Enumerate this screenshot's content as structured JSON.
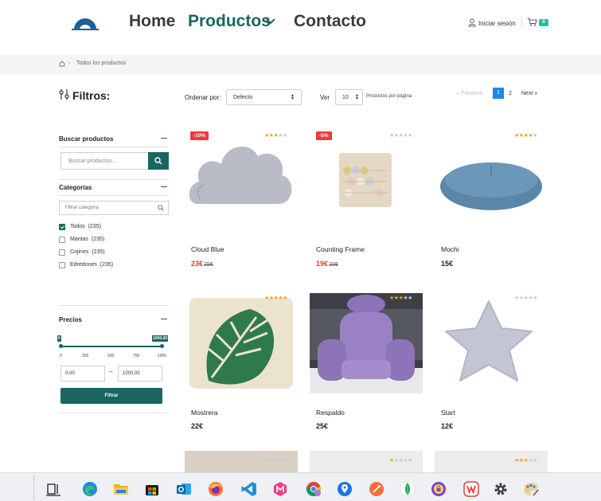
{
  "header": {
    "nav": {
      "home": "Home",
      "products": "Productos",
      "contact": "Contacto"
    },
    "login": "Iniciar sesión",
    "cart_count": "0"
  },
  "breadcrumb": {
    "current": "Todos los productos"
  },
  "sidebar": {
    "title": "Filtros:",
    "search": {
      "title": "Buscar productos",
      "placeholder": "Buscar productos..."
    },
    "categories": {
      "title": "Categorías",
      "filter_placeholder": "Filtrar categoría",
      "items": [
        {
          "label": "Todos",
          "count": "(235)",
          "checked": true
        },
        {
          "label": "Mantas",
          "count": "(235)",
          "checked": false
        },
        {
          "label": "Cojines",
          "count": "(235)",
          "checked": false
        },
        {
          "label": "Edredones",
          "count": "(235)",
          "checked": false
        }
      ]
    },
    "prices": {
      "title": "Precios",
      "range": [
        0,
        1000
      ],
      "handle_min": "0",
      "handle_max": "1000,00",
      "ticks": [
        "0",
        "250",
        "500",
        "750",
        "1000"
      ],
      "min_value": "0,00",
      "max_value": "1000,00",
      "dash": "–",
      "button": "Filtrar"
    }
  },
  "toolbar": {
    "order_label": "Ordenar por:",
    "order_value": "Defecto",
    "ver_label": "Ver",
    "ver_value": "10",
    "per_page": "Productos por página",
    "pagination": {
      "prev": "« Previous",
      "page1": "1",
      "page2": "2",
      "next": "Next »"
    }
  },
  "products": [
    {
      "name": "Cloud Blue",
      "price": "23€",
      "old_price": "25€",
      "badge": "-10%",
      "rating": 3
    },
    {
      "name": "Counting Frame",
      "price": "19€",
      "old_price": "20€",
      "badge": "-5%",
      "rating": 0
    },
    {
      "name": "Mochi",
      "price": "15€",
      "old_price": "",
      "badge": "",
      "rating": 4
    },
    {
      "name": "Mostrera",
      "price": "22€",
      "old_price": "",
      "badge": "",
      "rating": 5
    },
    {
      "name": "Respaldo",
      "price": "25€",
      "old_price": "",
      "badge": "",
      "rating": 3
    },
    {
      "name": "Start",
      "price": "12€",
      "old_price": "",
      "badge": "",
      "rating": 0
    },
    {
      "rating": 0
    },
    {
      "rating": 1
    },
    {
      "rating": 3
    }
  ],
  "icons": {
    "taskbar": [
      "task-view-icon",
      "edge-icon",
      "file-explorer-icon",
      "microsoft-store-icon",
      "outlook-icon",
      "firefox-icon",
      "vscode-icon",
      "app-m-icon",
      "chrome-icon",
      "maps-pin-icon",
      "postman-icon",
      "mongodb-icon",
      "app-lock-icon",
      "wps-office-icon",
      "settings-icon",
      "paint-icon"
    ]
  },
  "colors": {
    "brand": "#1a6560",
    "sale": "#e53935",
    "badge": "#ef3b3b",
    "star": "#f3a31b",
    "page_active": "#1e88e5",
    "cart_badge": "#21c39c"
  }
}
